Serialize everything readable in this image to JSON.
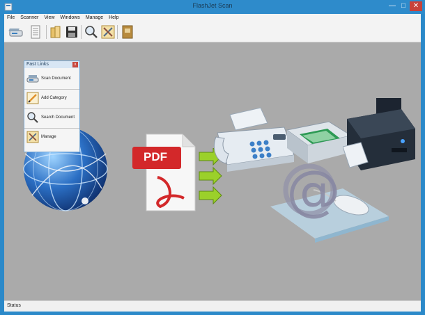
{
  "window": {
    "title": "FlashJet Scan"
  },
  "window_controls": {
    "minimize": "—",
    "maximize": "□",
    "close": "✕"
  },
  "menu": {
    "items": [
      "File",
      "Scanner",
      "View",
      "Windows",
      "Manage",
      "Help"
    ]
  },
  "toolbar": {
    "icons": [
      "scanner-icon",
      "document-icon",
      "folder-icon",
      "save-icon",
      "search-icon",
      "tools-icon",
      "book-icon"
    ]
  },
  "fast_links": {
    "title": "Fast Links",
    "close": "x",
    "items": [
      {
        "label": "Scan Document",
        "icon": "scanner-icon"
      },
      {
        "label": "Add Category",
        "icon": "pencil-icon"
      },
      {
        "label": "Search Document",
        "icon": "magnifier-icon"
      },
      {
        "label": "Manage",
        "icon": "tools-icon"
      }
    ]
  },
  "illustration": {
    "pdf_label": "PDF",
    "at_symbol": "@"
  },
  "status": {
    "text": "Status"
  },
  "colors": {
    "frame": "#2b89c9",
    "canvas": "#aaaaaa",
    "pdf_red": "#d3282a",
    "arrow_green": "#9bd02a"
  }
}
